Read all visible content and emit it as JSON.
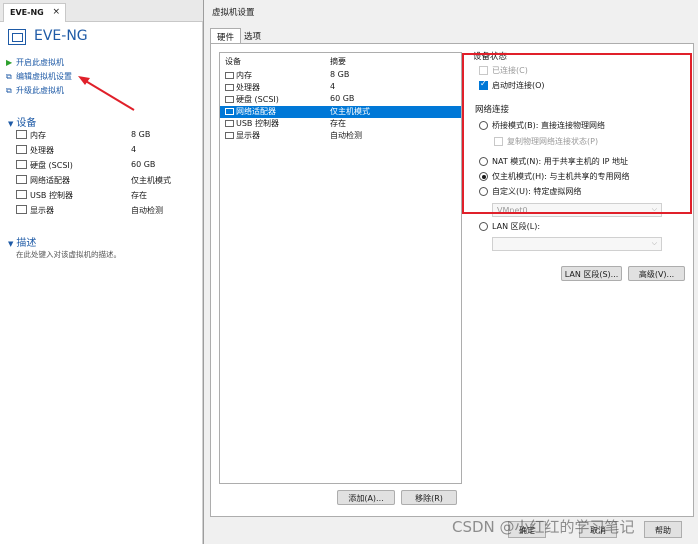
{
  "left": {
    "tab_label": "EVE-NG",
    "tab_close": "×",
    "vm_title": "EVE-NG",
    "actions": [
      {
        "label": "开启此虚拟机",
        "icon": "play-icon"
      },
      {
        "label": "编辑虚拟机设置",
        "icon": "edit-settings-icon"
      },
      {
        "label": "升级此虚拟机",
        "icon": "upgrade-icon"
      }
    ],
    "devices_header": "设备",
    "devices": [
      {
        "name": "内存",
        "value": "8 GB",
        "icon": "memory-icon"
      },
      {
        "name": "处理器",
        "value": "4",
        "icon": "cpu-icon"
      },
      {
        "name": "硬盘 (SCSI)",
        "value": "60 GB",
        "icon": "hard-disk-icon"
      },
      {
        "name": "网络适配器",
        "value": "仅主机模式",
        "icon": "network-adapter-icon"
      },
      {
        "name": "USB 控制器",
        "value": "存在",
        "icon": "usb-icon"
      },
      {
        "name": "显示器",
        "value": "自动检测",
        "icon": "display-icon"
      }
    ],
    "description_header": "描述",
    "description_text": "在此处键入对该虚拟机的描述。"
  },
  "dialog": {
    "title": "虚拟机设置",
    "tabs": [
      "硬件",
      "选项"
    ],
    "list_headers": [
      "设备",
      "摘要"
    ],
    "list": [
      {
        "name": "内存",
        "value": "8 GB",
        "icon": "memory-icon"
      },
      {
        "name": "处理器",
        "value": "4",
        "icon": "cpu-icon"
      },
      {
        "name": "硬盘 (SCSI)",
        "value": "60 GB",
        "icon": "hard-disk-icon"
      },
      {
        "name": "网络适配器",
        "value": "仅主机模式",
        "icon": "network-adapter-icon",
        "selected": true
      },
      {
        "name": "USB 控制器",
        "value": "存在",
        "icon": "usb-icon"
      },
      {
        "name": "显示器",
        "value": "自动检测",
        "icon": "display-icon"
      }
    ],
    "add_button": "添加(A)...",
    "remove_button": "移除(R)",
    "device_status": {
      "header": "设备状态",
      "connected": "已连接(C)",
      "connect_on_power": "启动时连接(O)"
    },
    "network": {
      "header": "网络连接",
      "bridged": "桥接模式(B): 直接连接物理网络",
      "replicate": "复制物理网络连接状态(P)",
      "nat": "NAT 模式(N): 用于共享主机的 IP 地址",
      "host_only": "仅主机模式(H): 与主机共享的专用网络",
      "custom": "自定义(U): 特定虚拟网络",
      "custom_value": "VMnet0",
      "lan": "LAN 区段(L):",
      "lan_value": ""
    },
    "lan_segments_button": "LAN 区段(S)...",
    "advanced_button": "高级(V)...",
    "ok_button": "确定",
    "cancel_button": "取消",
    "help_button": "帮助"
  },
  "watermark": "CSDN @小红红的学习笔记",
  "colors": {
    "accent": "#0078d7",
    "link": "#1e5aa6",
    "highlight_box": "#e0202a"
  }
}
